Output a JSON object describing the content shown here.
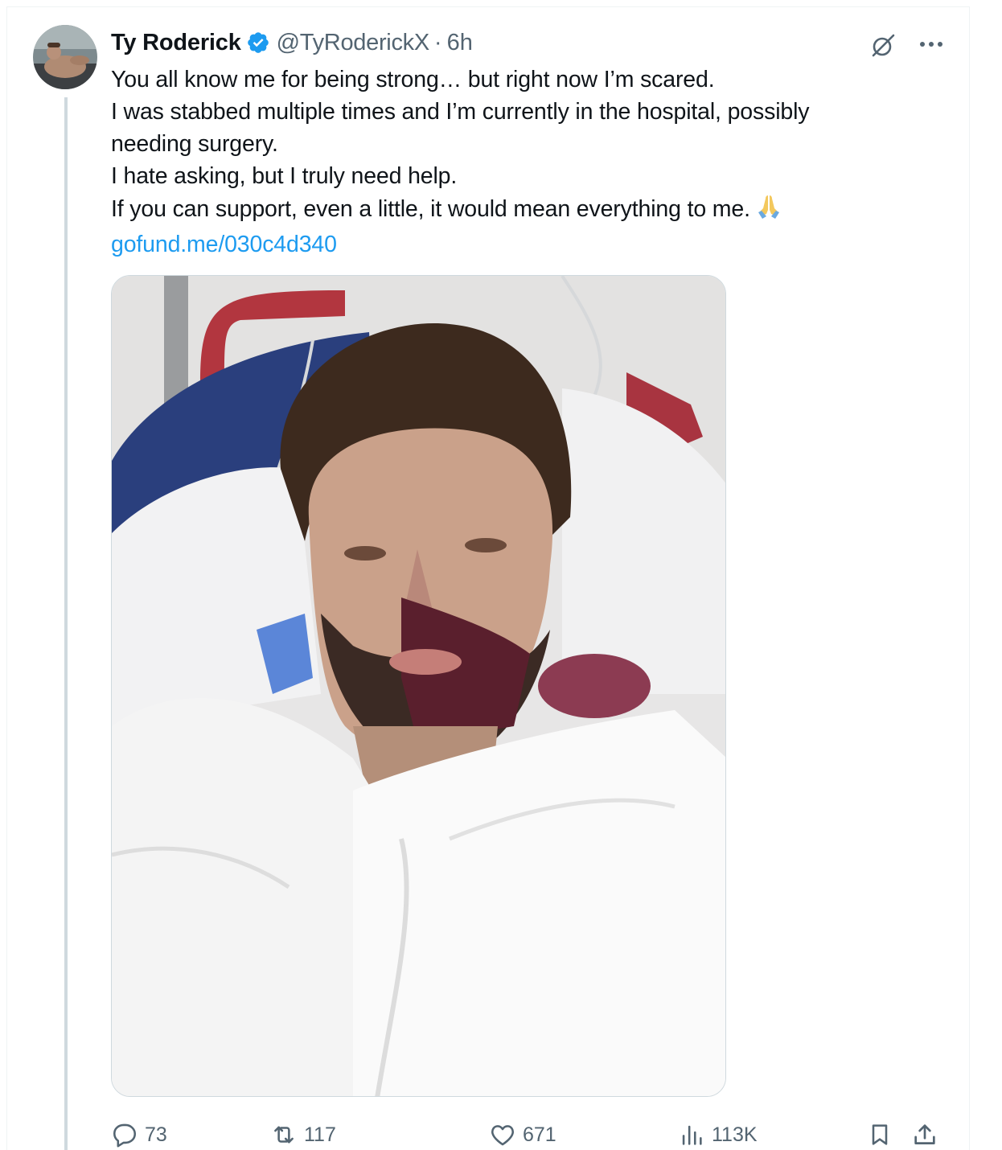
{
  "author": {
    "display_name": "Ty Roderick",
    "handle": "@TyRoderickX",
    "separator": "·",
    "time": "6h",
    "verified": true
  },
  "tweet": {
    "lines": [
      "You all know me for being strong… but right now I’m scared.",
      "I was stabbed multiple times and I’m currently in the hospital, possibly",
      "needing surgery.",
      "I hate asking, but I truly need help.",
      "If you can support, even a little, it would mean everything to me."
    ],
    "emoji": "folded-hands",
    "link": "gofund.me/030c4d340"
  },
  "actions": {
    "replies": "73",
    "reposts": "117",
    "likes": "671",
    "views": "113K"
  },
  "icons": [
    "verified-badge-icon",
    "grok-icon",
    "more-icon",
    "reply-icon",
    "repost-icon",
    "like-icon",
    "views-icon",
    "bookmark-icon",
    "share-icon"
  ],
  "colors": {
    "accent": "#1d9bf0",
    "secondary_text": "#536471",
    "primary_text": "#0f1419",
    "border": "#cfd9de"
  }
}
